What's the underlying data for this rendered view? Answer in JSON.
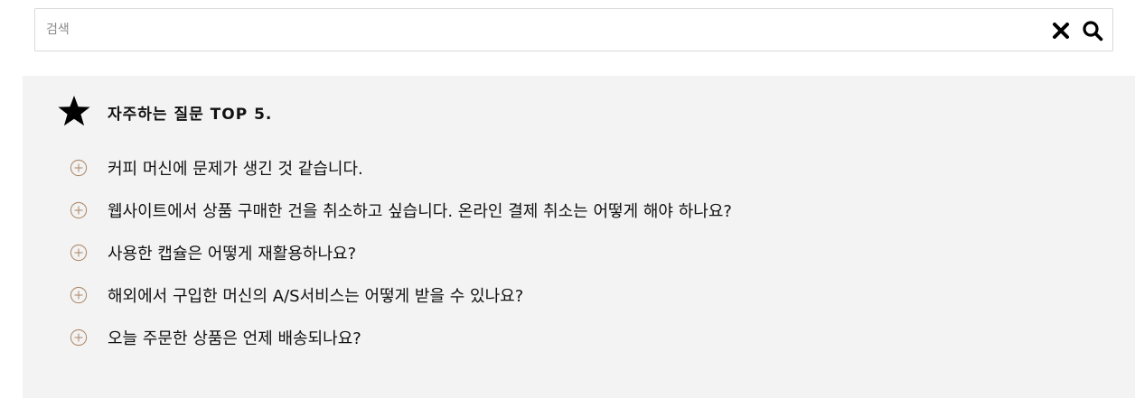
{
  "search": {
    "placeholder": "검색",
    "value": "",
    "clear_icon": "close-icon",
    "search_icon": "search-icon"
  },
  "faq": {
    "title": "자주하는 질문 TOP 5.",
    "title_icon": "star-icon",
    "item_icon": "plus-circle-icon",
    "accent_color": "#b08d6e",
    "items": [
      {
        "question": "커피 머신에 문제가 생긴 것 같습니다."
      },
      {
        "question": "웹사이트에서 상품 구매한 건을 취소하고 싶습니다. 온라인 결제 취소는 어떻게 해야 하나요?"
      },
      {
        "question": "사용한 캡슐은 어떻게 재활용하나요?"
      },
      {
        "question": "해외에서 구입한 머신의 A/S서비스는 어떻게 받을 수 있나요?"
      },
      {
        "question": "오늘 주문한 상품은 언제 배송되나요?"
      }
    ]
  }
}
